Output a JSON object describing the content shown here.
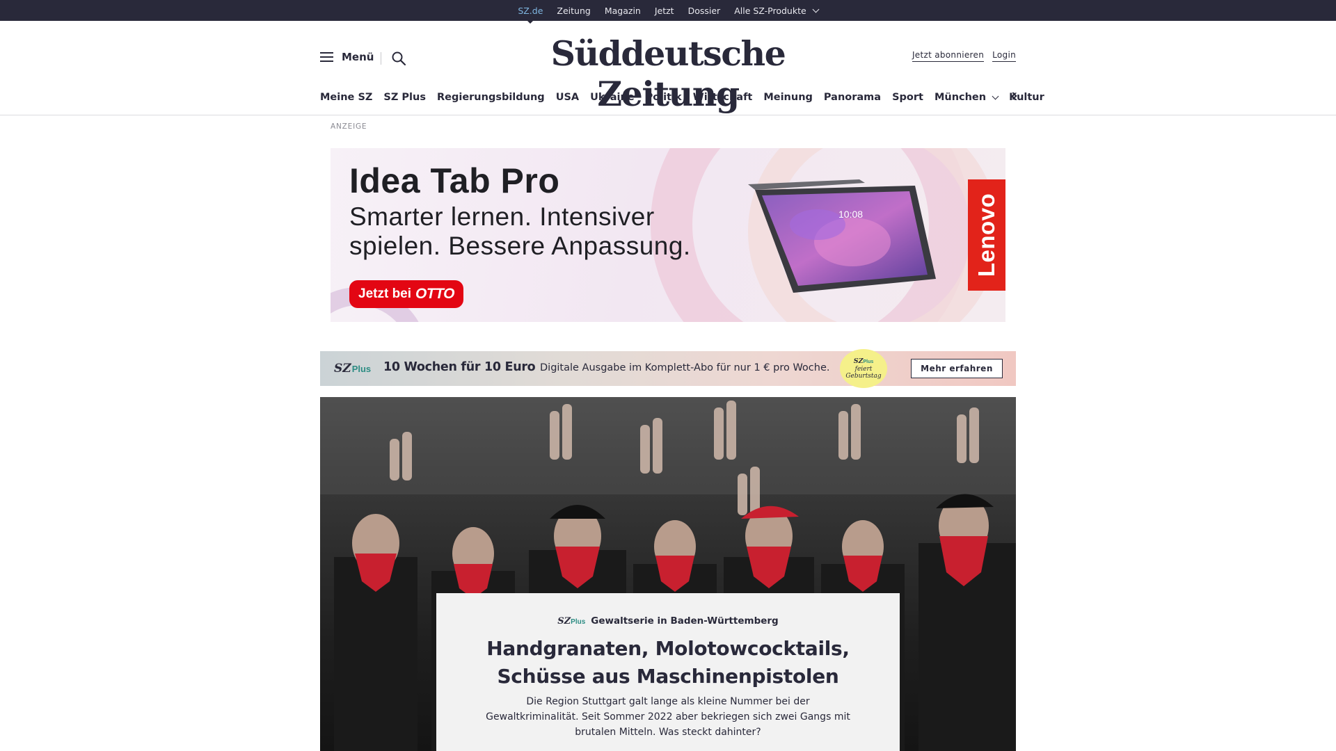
{
  "topbar": {
    "items": [
      "SZ.de",
      "Zeitung",
      "Magazin",
      "Jetzt",
      "Dossier",
      "Alle SZ-Produkte"
    ]
  },
  "header": {
    "menu_label": "Menü",
    "logo_text": "Süddeutsche Zeitung",
    "subscribe_label": "Jetzt abonnieren",
    "login_label": "Login"
  },
  "nav": {
    "items": [
      "Meine SZ",
      "SZ Plus",
      "Regierungsbildung",
      "USA",
      "Ukraine",
      "Politik",
      "Wirtschaft",
      "Meinung",
      "Panorama",
      "Sport",
      "München",
      "Kultur"
    ]
  },
  "ad": {
    "label": "ANZEIGE",
    "title": "Idea Tab Pro",
    "tagline": "Smarter lernen. Intensiver spielen. Bessere Anpassung.",
    "cta_prefix": "Jetzt bei",
    "cta_brand": "OTTO",
    "brand": "Lenovo",
    "tablet_time": "10:08"
  },
  "promo": {
    "logo": "SZ",
    "logo_plus": "Plus",
    "headline": "10 Wochen für 10 Euro",
    "sub": "Digitale Ausgabe im Komplett-Abo für nur 1 € pro Woche.",
    "bubble_logo": "SZ",
    "bubble_plus": "Plus",
    "bubble_line1": "feiert",
    "bubble_line2": "Geburtstag",
    "button_label": "Mehr erfahren"
  },
  "teaser": {
    "badge": "SZ",
    "badge_plus": "Plus",
    "kicker": "Gewaltserie in Baden-Württemberg",
    "headline": "Handgranaten, Molotowcocktails, Schüsse aus Maschinenpistolen",
    "summary": "Die Region Stuttgart galt lange als kleine Nummer bei der Gewaltkriminalität. Seit Sommer 2022 aber bekriegen sich zwei Gangs mit brutalen Mitteln. Was steckt dahinter?"
  },
  "colors": {
    "topbar_bg": "#29293a",
    "text": "#29293a",
    "sz_plus_accent": "#2c8c83",
    "otto_red": "#e30613",
    "lenovo_red": "#e2231a",
    "bandana_red": "#c8202f"
  }
}
